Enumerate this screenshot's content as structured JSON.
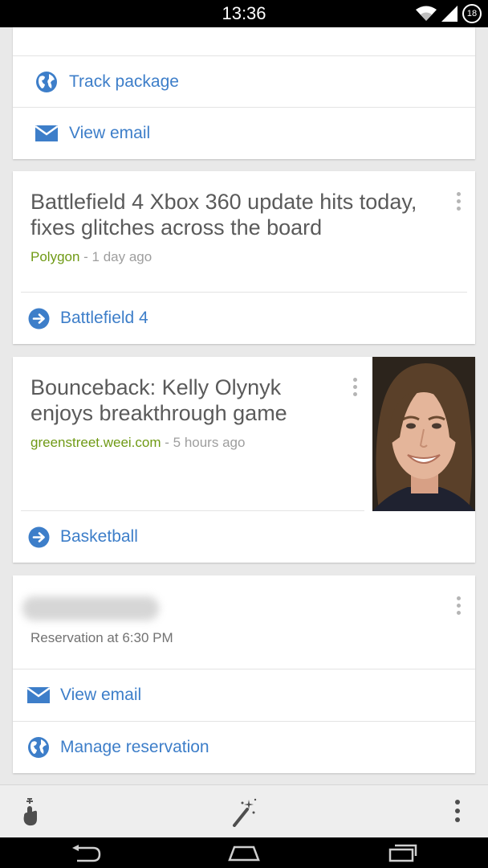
{
  "status_bar": {
    "time": "13:36",
    "battery": "18"
  },
  "card1": {
    "actions": [
      {
        "label": "Track package",
        "icon": "globe-icon"
      },
      {
        "label": "View email",
        "icon": "envelope-icon"
      }
    ]
  },
  "card2": {
    "headline": "Battlefield 4 Xbox 360 update hits today, fixes glitches across the board",
    "source": "Polygon",
    "time_sep": " - ",
    "time": "1 day ago",
    "topic": "Battlefield 4",
    "topic_icon": "arrow-circle-icon"
  },
  "card3": {
    "headline": "Bounceback: Kelly Olynyk enjoys breakthrough game",
    "source": "greenstreet.weei.com",
    "time_sep": " - ",
    "time": "5 hours ago",
    "topic": "Basketball",
    "topic_icon": "arrow-circle-icon",
    "image": "player-photo"
  },
  "card4": {
    "reservation": "Reservation at 6:30 PM",
    "actions": [
      {
        "label": "View email",
        "icon": "envelope-icon"
      },
      {
        "label": "Manage reservation",
        "icon": "globe-icon"
      }
    ]
  },
  "toolbar": {
    "icons": [
      "remind-gesture-icon",
      "magic-wand-icon",
      "overflow-menu-icon"
    ]
  },
  "nav": {
    "icons": [
      "back-icon",
      "home-icon",
      "recents-icon"
    ]
  },
  "colors": {
    "link": "#3d7ec9",
    "source": "#6f9a15",
    "headline": "#5a5a5a",
    "meta": "#9e9e9e"
  }
}
